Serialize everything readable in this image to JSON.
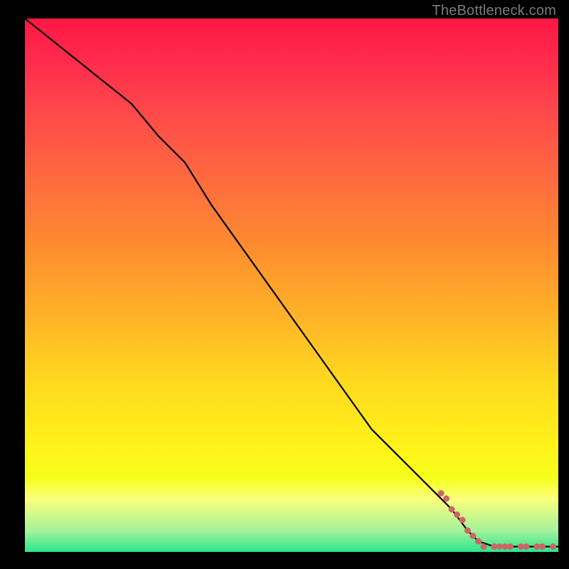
{
  "watermark": "TheBottleneck.com",
  "colors": {
    "background": "#000000",
    "line": "#000000",
    "marker": "#cc6666",
    "watermark_text": "#7b7b7b"
  },
  "chart_data": {
    "type": "line",
    "title": "",
    "xlabel": "",
    "ylabel": "",
    "xlim": [
      0,
      100
    ],
    "ylim": [
      0,
      100
    ],
    "series": [
      {
        "name": "bottleneck-curve",
        "x": [
          0,
          5,
          10,
          15,
          20,
          25,
          30,
          35,
          40,
          45,
          50,
          55,
          60,
          65,
          70,
          75,
          80,
          83,
          85,
          88,
          90,
          92,
          94,
          96,
          98,
          100
        ],
        "y": [
          100,
          96,
          92,
          88,
          84,
          78,
          73,
          65,
          58,
          51,
          44,
          37,
          30,
          23,
          18,
          13,
          8,
          4,
          2,
          1,
          1,
          1,
          1,
          1,
          1,
          1
        ]
      }
    ],
    "markers": {
      "name": "tail-markers",
      "x": [
        78,
        79,
        80,
        81,
        82,
        83,
        84,
        85,
        86,
        88,
        89,
        90,
        91,
        93,
        94,
        96,
        97,
        99
      ],
      "y": [
        11,
        10,
        8,
        7,
        6,
        4,
        3,
        2,
        1,
        1,
        1,
        1,
        1,
        1,
        1,
        1,
        1,
        1
      ]
    },
    "gradient_stops": [
      {
        "pos": 0,
        "color": "#ff1744"
      },
      {
        "pos": 18,
        "color": "#ff4a4a"
      },
      {
        "pos": 42,
        "color": "#ff8a30"
      },
      {
        "pos": 68,
        "color": "#ffd91f"
      },
      {
        "pos": 90,
        "color": "#fbff7a"
      },
      {
        "pos": 100,
        "color": "#2ae68e"
      }
    ]
  }
}
